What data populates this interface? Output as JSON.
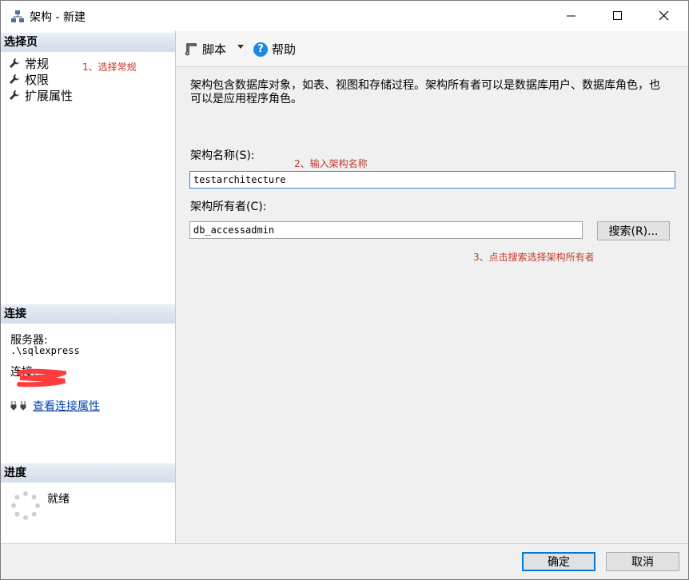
{
  "window": {
    "title": "架构 - 新建"
  },
  "left": {
    "select_page_header": "选择页",
    "nav_items": [
      {
        "label": "常规",
        "icon": "wrench-icon"
      },
      {
        "label": "权限",
        "icon": "wrench-icon"
      },
      {
        "label": "扩展属性",
        "icon": "wrench-icon"
      }
    ],
    "annotation_1": "1、选择常规",
    "connection_header": "连接",
    "server_label": "服务器:",
    "server_value": ".\\sqlexpress",
    "connection_label": "连接:",
    "view_connection_link": "查看连接属性",
    "progress_header": "进度",
    "progress_status": "就绪"
  },
  "toolbar": {
    "script_label": "脚本",
    "help_label": "帮助"
  },
  "main": {
    "description": "架构包含数据库对象，如表、视图和存储过程。架构所有者可以是数据库用户、数据库角色，也可以是应用程序角色。",
    "schema_name_label": "架构名称(S):",
    "annotation_2": "2、输入架构名称",
    "schema_name_value": "testarchitecture",
    "schema_owner_label": "架构所有者(C):",
    "schema_owner_value": "db_accessadmin",
    "search_button": "搜索(R)...",
    "annotation_3": "3、点击搜索选择架构所有者"
  },
  "footer": {
    "ok_button": "确定",
    "cancel_button": "取消"
  },
  "colors": {
    "annotation": "#c0392b",
    "link": "#0645ad",
    "focus": "#0078d7",
    "redaction": "#ff3b3b"
  }
}
